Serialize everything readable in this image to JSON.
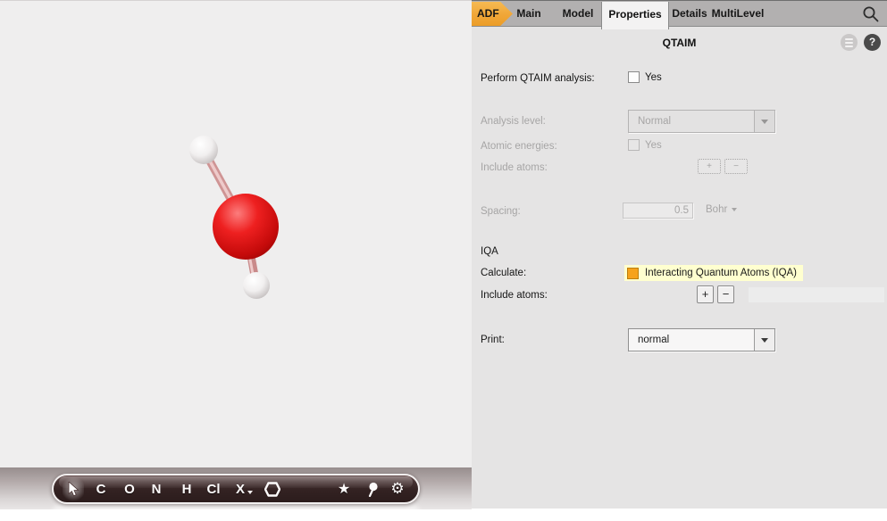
{
  "tabbar": {
    "adf": "ADF",
    "main": "Main",
    "model": "Model",
    "properties": "Properties",
    "details": "Details",
    "multilevel": "MultiLevel",
    "search_icon": "magnifier"
  },
  "panel": {
    "title": "QTAIM",
    "menu_icon": "menu-circle",
    "help_icon": "question-circle",
    "help_glyph": "?"
  },
  "form": {
    "perform_label": "Perform QTAIM analysis:",
    "perform_yes": "Yes",
    "analysis_label": "Analysis level:",
    "analysis_value": "Normal",
    "atomic_label": "Atomic energies:",
    "atomic_yes": "Yes",
    "include1_label": "Include atoms:",
    "plus": "+",
    "minus": "−",
    "spacing_label": "Spacing:",
    "spacing_value": "0.5",
    "spacing_unit": "Bohr",
    "iqa_heading": "IQA",
    "calculate_label": "Calculate:",
    "calculate_option": "Interacting Quantum Atoms (IQA)",
    "include2_label": "Include atoms:",
    "print_label": "Print:",
    "print_value": "normal"
  },
  "states": {
    "perform_checked": false,
    "atomic_checked": false,
    "calculate_checked": true
  },
  "toolbar": {
    "elements": [
      "C",
      "O",
      "N",
      "H",
      "Cl",
      "X"
    ],
    "icons": [
      "cursor",
      "ring-hexagon",
      "star",
      "balloon",
      "gear"
    ],
    "star_glyph": "★",
    "gear_glyph": "⚙"
  },
  "colors": {
    "accent_orange": "#F0A637",
    "option_highlight": "#FFFFCF",
    "oxygen_red": "#E31414",
    "hydrogen_white": "#F5F3F3",
    "bond_pink": "#D29A9A",
    "toolbar_brown": "#362424"
  }
}
